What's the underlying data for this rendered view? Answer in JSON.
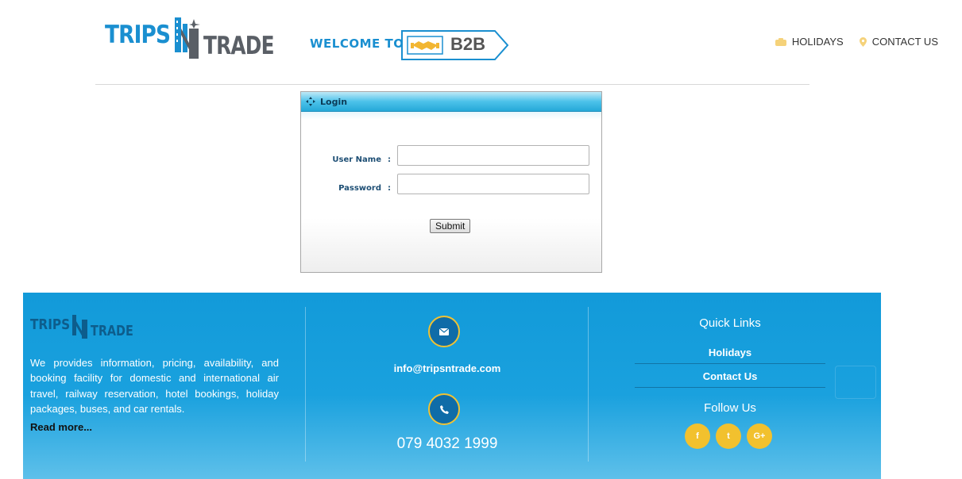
{
  "header": {
    "logo": {
      "part1": "TRIPS",
      "part2": "N",
      "part3": "TRADE"
    },
    "welcome": "WELCOME TO",
    "b2b": "B2B",
    "nav": [
      {
        "label": "HOLIDAYS",
        "icon": "holiday-icon"
      },
      {
        "label": "CONTACT US",
        "icon": "location-pin-icon"
      }
    ]
  },
  "login": {
    "title": "Login",
    "username_label": "User Name",
    "password_label": "Password",
    "colon": ":",
    "username_value": "",
    "password_value": "",
    "submit_label": "Submit"
  },
  "footer": {
    "logo": {
      "part1": "TRIPS",
      "part2": "N",
      "part3": "TRADE"
    },
    "about": "We provides information, pricing, availability, and booking facility for domestic and international air travel, railway reservation, hotel bookings, holiday packages, buses, and car rentals.",
    "read_more": "Read more...",
    "email": "info@tripsntrade.com",
    "phone": "079 4032 1999",
    "quick_links_title": "Quick Links",
    "quick_links": [
      "Holidays",
      "Contact Us"
    ],
    "follow_title": "Follow Us",
    "social": [
      {
        "label": "f",
        "icon": "facebook-icon"
      },
      {
        "label": "t",
        "icon": "twitter-icon"
      },
      {
        "label": "G+",
        "icon": "google-plus-icon"
      }
    ]
  },
  "colors": {
    "brand_blue": "#1a8fd0",
    "footer_blue": "#129ad9",
    "accent_yellow": "#f2c12e",
    "login_header": "#25a9d8"
  }
}
